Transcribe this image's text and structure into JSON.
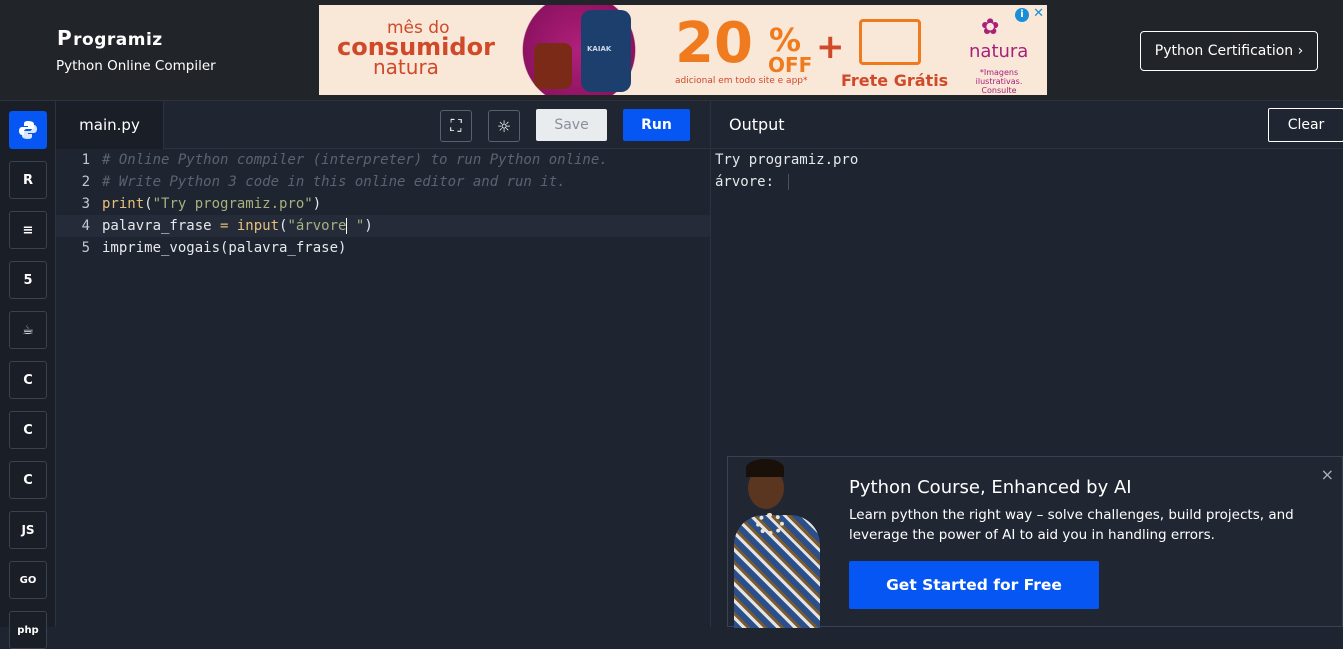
{
  "header": {
    "logo_text": "rogramiz",
    "logo_mark": "P",
    "subtitle": "Python Online Compiler",
    "cert_button": "Python Certification ›"
  },
  "ad": {
    "line1": "mês do",
    "line2": "consumidor",
    "line3": "natura",
    "bottle_label": "KAIAK",
    "percent": "20",
    "percent_sign": "%",
    "off": "OFF",
    "small_note": "adicional em todo site e app*",
    "plus": "+",
    "frete": "Frete Grátis",
    "brand": "natura",
    "disclaimer": "*Imagens ilustrativas. Consulte condições.",
    "colors": {
      "background": "#f9e7d8",
      "orange": "#f07a1e",
      "magenta": "#a8207a"
    }
  },
  "sidebar": {
    "languages": [
      {
        "icon": "python-icon",
        "glyph": "Py",
        "active": true
      },
      {
        "icon": "r-icon",
        "glyph": "R",
        "active": false
      },
      {
        "icon": "sql-icon",
        "glyph": "≡",
        "active": false
      },
      {
        "icon": "html5-icon",
        "glyph": "5",
        "active": false
      },
      {
        "icon": "java-icon",
        "glyph": "☕",
        "active": false
      },
      {
        "icon": "c-icon",
        "glyph": "C",
        "active": false
      },
      {
        "icon": "cpp-icon",
        "glyph": "C",
        "active": false
      },
      {
        "icon": "csharp-icon",
        "glyph": "C",
        "active": false
      },
      {
        "icon": "js-icon",
        "glyph": "JS",
        "active": false
      },
      {
        "icon": "go-icon",
        "glyph": "GO",
        "active": false
      },
      {
        "icon": "php-icon",
        "glyph": "php",
        "active": false
      }
    ]
  },
  "editor": {
    "tab": "main.py",
    "fullscreen_icon": "⛶",
    "theme_icon": "☼",
    "save_label": "Save",
    "run_label": "Run",
    "lines": [
      {
        "n": "1",
        "text": "# Online Python compiler (interpreter) to run Python online."
      },
      {
        "n": "2",
        "text": "# Write Python 3 code in this online editor and run it."
      },
      {
        "n": "3",
        "fn": "print",
        "open": "(",
        "str": "\"Try programiz.pro\"",
        "close": ")"
      },
      {
        "n": "4",
        "var": "palavra_frase ",
        "op": "= ",
        "fn": "input",
        "open": "(",
        "str": "\"árvore",
        "str2": " \"",
        "close": ")"
      },
      {
        "n": "5",
        "text": "imprime_vogais(palavra_frase)"
      }
    ]
  },
  "output": {
    "title": "Output",
    "clear_label": "Clear",
    "lines": [
      "Try programiz.pro",
      "árvore: "
    ]
  },
  "promo": {
    "title": "Python Course, Enhanced by AI",
    "description": "Learn python the right way – solve challenges, build projects, and leverage the power of AI to aid you in handling errors.",
    "button": "Get Started for Free",
    "close": "×"
  },
  "colors": {
    "accent": "#0556f3",
    "background": "#1e2430",
    "header": "#212529"
  }
}
